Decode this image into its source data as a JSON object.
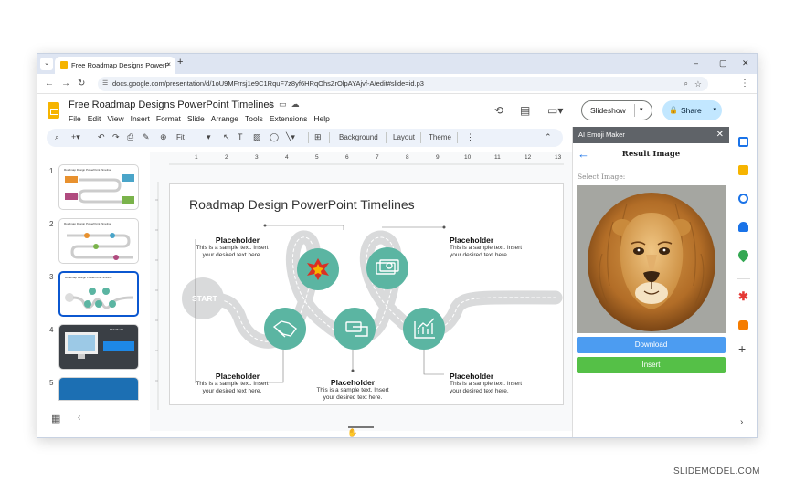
{
  "browser": {
    "tab_title": "Free Roadmap Designs PowerP",
    "tab_close": "×",
    "new_tab": "+",
    "url": "docs.google.com/presentation/d/1oU9MFrrsj1e9C1RquF7z8yf6HRqOhsZrOlpAYAjvf-A/edit#slide=id.p3",
    "window_controls": [
      "–",
      "▢",
      "✕"
    ]
  },
  "docs": {
    "title": "Free Roadmap Designs PowerPoint Timelines",
    "menus": [
      "File",
      "Edit",
      "View",
      "Insert",
      "Format",
      "Slide",
      "Arrange",
      "Tools",
      "Extensions",
      "Help"
    ],
    "slideshow_label": "Slideshow",
    "share_label": "Share"
  },
  "toolbar": {
    "zoom_label": "Fit",
    "background_label": "Background",
    "layout_label": "Layout",
    "theme_label": "Theme"
  },
  "filmstrip": {
    "slides": [
      {
        "number": "1",
        "title": "Roadmap Design PowerPoint Timeline"
      },
      {
        "number": "2",
        "title": "Roadmap Design PowerPoint Timeline"
      },
      {
        "number": "3",
        "title": "Roadmap Design PowerPoint Timeline"
      },
      {
        "number": "4",
        "title": "SlideModel"
      },
      {
        "number": "5",
        "title": ""
      }
    ]
  },
  "ruler": {
    "marks": [
      "1",
      "2",
      "3",
      "4",
      "5",
      "6",
      "7",
      "8",
      "9",
      "10",
      "11",
      "12",
      "13"
    ]
  },
  "slide": {
    "title": "Roadmap Design PowerPoint Timelines",
    "start_label": "START",
    "placeholders": [
      {
        "heading": "Placeholder",
        "body1": "This is a sample text. Insert",
        "body2": "your desired text here."
      },
      {
        "heading": "Placeholder",
        "body1": "This is a sample text. Insert",
        "body2": "your desired text here."
      },
      {
        "heading": "Placeholder",
        "body1": "This is a sample text. Insert",
        "body2": "your desired text here."
      },
      {
        "heading": "Placeholder",
        "body1": "This is a sample text. Insert",
        "body2": "your desired text here."
      },
      {
        "heading": "Placeholder",
        "body1": "This is a sample text. Insert",
        "body2": "your desired text here."
      }
    ]
  },
  "panel": {
    "header": "AI Emoji Maker",
    "result_title": "Result Image",
    "select_label": "Select Image:",
    "download_label": "Download",
    "insert_label": "Insert"
  },
  "colors": {
    "teal": "#5bb5a2",
    "road": "#d9dadb",
    "download": "#4c9cf1",
    "insert": "#55c047",
    "share": "#c2e7ff"
  },
  "watermark": "SLIDEMODEL.COM"
}
